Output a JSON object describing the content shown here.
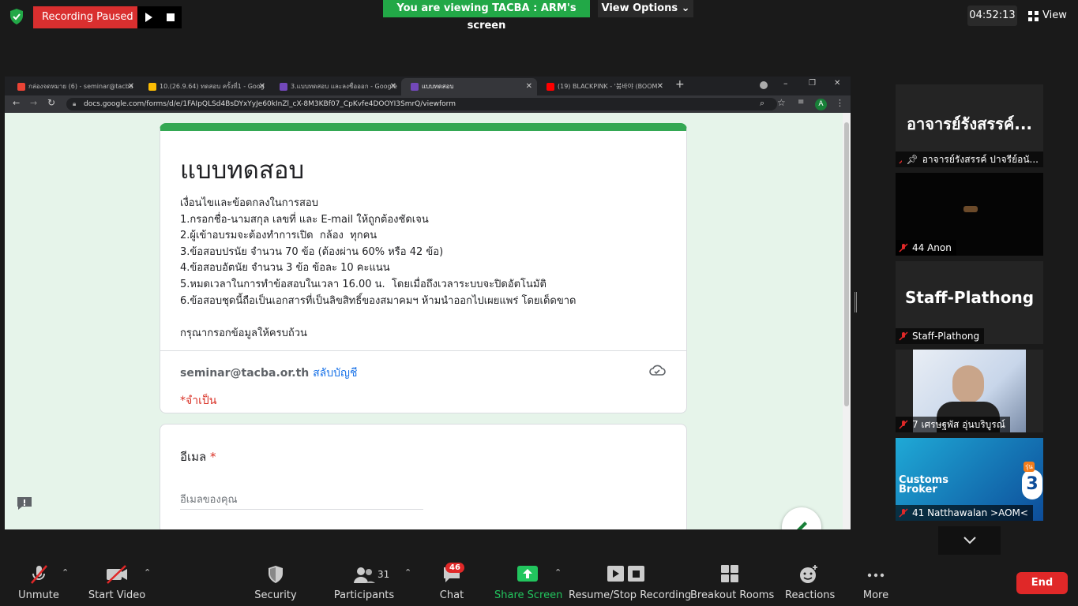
{
  "top": {
    "recording_label": "Recording Paused",
    "viewing_banner": "You are viewing TACBA : ARM's screen",
    "view_options": "View Options",
    "clock": "04:52:13",
    "view_label": "View"
  },
  "browser": {
    "tabs": [
      {
        "label": "กล่องจดหมาย (6) - seminar@tacba",
        "favicon": "gmail-icon",
        "color": "#ea4335"
      },
      {
        "label": "10.(26.9.64) ทดสอบ ครั้งที่1 - Goog",
        "favicon": "drive-icon",
        "color": "#fbbc04"
      },
      {
        "label": "3.แบบทดสอบ และลงชื่อออก - Google",
        "favicon": "forms-icon",
        "color": "#7248b9"
      },
      {
        "label": "แบบทดสอบ",
        "favicon": "forms-icon",
        "color": "#7248b9"
      },
      {
        "label": "(19) BLACKPINK - '붐바야 (BOOM",
        "favicon": "youtube-icon",
        "color": "#ff0000"
      }
    ],
    "url": "docs.google.com/forms/d/e/1FAIpQLSd4BsDYxYyJe60kInZl_cX-8M3KBf07_CpKvfe4DOOYI3SmrQ/viewform",
    "avatar_letter": "A"
  },
  "form": {
    "title": "แบบทดสอบ",
    "description": "เงื่อนไขและข้อตกลงในการสอบ\n1.กรอกชื่อ-นามสกุล เลขที่ และ E-mail ให้ถูกต้องชัดเจน\n2.ผู้เข้าอบรมจะต้องทำการเปิด  กล้อง  ทุกคน\n3.ข้อสอบปรนัย จำนวน 70 ข้อ (ต้องผ่าน 60% หรือ 42 ข้อ)\n4.ข้อสอบอัตนัย จำนวน 3 ข้อ ข้อละ 10 คะแนน\n5.หมดเวลาในการทำข้อสอบในเวลา 16.00 น.  โดยเมื่อถึงเวลาระบบจะปิดอัตโนมัติ\n6.ข้อสอบชุดนี้ถือเป็นเอกสารที่เป็นลิขสิทธิ์ของสมาคมฯ ห้ามนำออกไปเผยแพร่ โดยเด็ดขาด\n\nกรุณากรอกข้อมูลให้ครบถ้วน",
    "account_email": "seminar@tacba.or.th",
    "switch_account": "สลับบัญชี",
    "required_note": "*จำเป็น",
    "question_label": "อีเมล",
    "required_star": "*",
    "input_placeholder": "อีเมลของคุณ"
  },
  "participants": [
    {
      "big": "อาจารย์รังสรรค์...",
      "name": "อาจารย์รังสรรค์ ปาจรีย์อนั...",
      "pinned": true
    },
    {
      "big": "",
      "name": "44 Anon",
      "pinned": false
    },
    {
      "big": "Staff-Plathong",
      "name": "Staff-Plathong",
      "pinned": false
    },
    {
      "big": "",
      "name": "7 เศรษฐพัส อุ่นบริบูรณ์",
      "pinned": false
    },
    {
      "big": "",
      "name": "41 Natthawalan >AOM<",
      "pinned": false
    },
    {
      "video_text": "Customs Broker",
      "badge": "3",
      "extra": "รุ่น"
    }
  ],
  "toolbar": {
    "unmute": "Unmute",
    "start_video": "Start Video",
    "security": "Security",
    "participants": "Participants",
    "participants_count": "31",
    "chat": "Chat",
    "chat_badge": "46",
    "share_screen": "Share Screen",
    "resume_stop": "Resume/Stop Recording",
    "breakout": "Breakout Rooms",
    "reactions": "Reactions",
    "more": "More",
    "end": "End"
  },
  "colors": {
    "accent_green": "#22a847",
    "record_red": "#d92f2f",
    "forms_green": "#34a853",
    "end_red": "#e02828"
  }
}
